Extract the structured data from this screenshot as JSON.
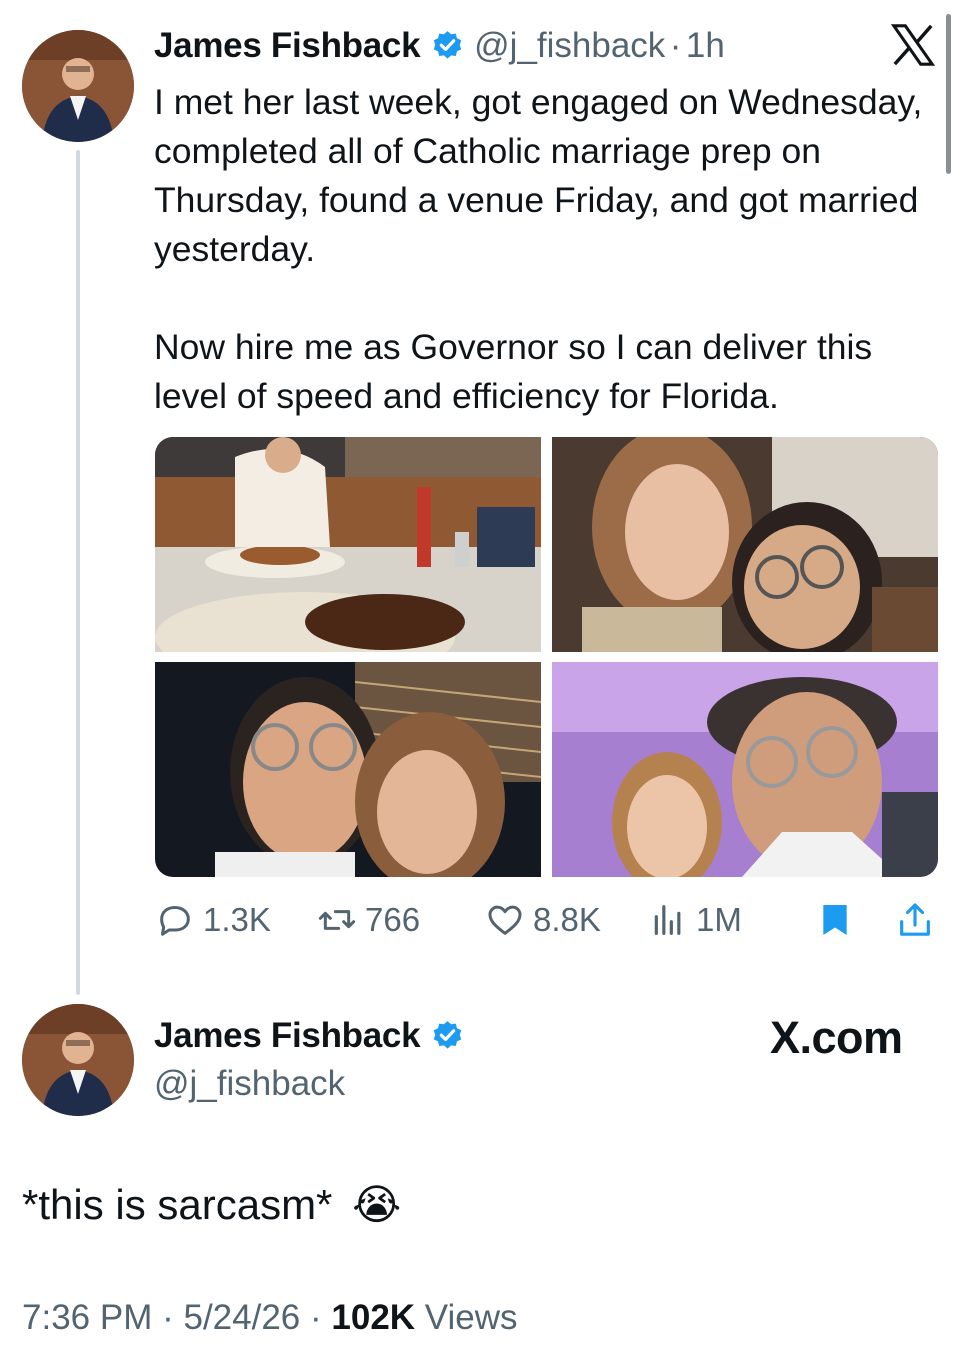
{
  "tweet": {
    "author_name": "James Fishback",
    "handle": "@j_fishback",
    "time": "1h",
    "text_p1": "I met her last week, got engaged on Wednesday, completed all of Catholic marriage prep on Thursday, found a venue Friday, and got married yesterday.",
    "text_p2": "Now hire me as Governor so I can deliver this level of speed and efficiency for Florida.",
    "photos": [
      "restaurant-dinner-photo",
      "couple-selfie-indoor-photo",
      "couple-selfie-night-photo",
      "couple-selfie-airplane-photo"
    ],
    "stats": {
      "replies": "1.3K",
      "reposts": "766",
      "likes": "8.8K",
      "views": "1M"
    },
    "accent_color": "#1d9bf0"
  },
  "reply": {
    "author_name": "James Fishback",
    "handle": "@j_fishback",
    "brand": "X.com",
    "text": "*this is sarcasm*",
    "emoji": "😭",
    "timestamp": "7:36 PM",
    "date": "5/24/26",
    "views_count": "102K",
    "views_label": "Views"
  },
  "icons": [
    "x-logo",
    "verified-badge",
    "reply-icon",
    "repost-icon",
    "like-icon",
    "views-icon",
    "bookmark-icon",
    "share-icon"
  ]
}
